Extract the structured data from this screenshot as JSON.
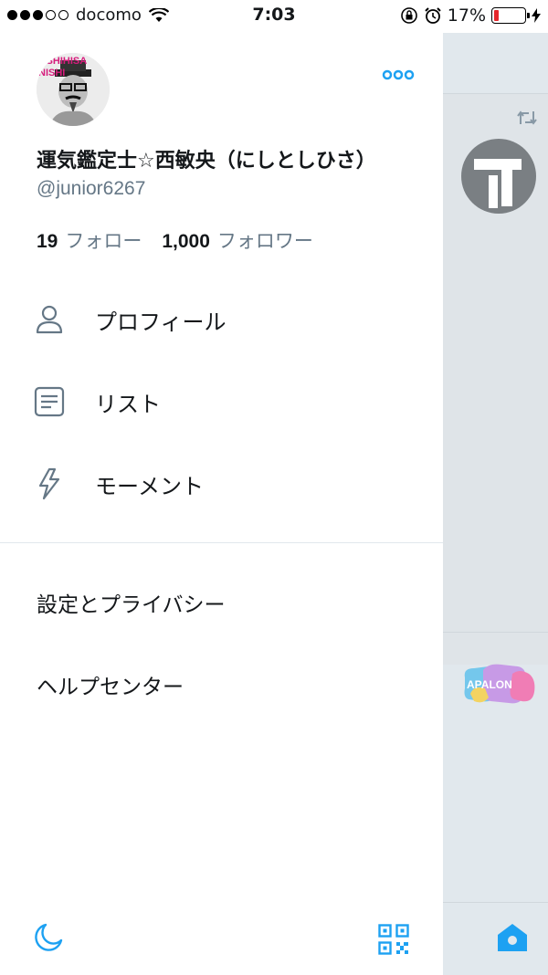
{
  "status_bar": {
    "carrier": "docomo",
    "time": "7:03",
    "battery_percent": "17%",
    "battery_level": 0.17,
    "signal_bars_filled": 3,
    "signal_bars_total": 5
  },
  "profile": {
    "avatar_text": "OSHIHISA NISHI",
    "display_name": "運気鑑定士☆西敏央（にしとしひさ）",
    "handle": "@junior6267",
    "following_count": "19",
    "following_label": "フォロー",
    "followers_count": "1,000",
    "followers_label": "フォロワー",
    "more_icon": "more-dots-icon"
  },
  "menu": [
    {
      "label": "プロフィール",
      "icon": "person-icon"
    },
    {
      "label": "リスト",
      "icon": "list-icon"
    },
    {
      "label": "モーメント",
      "icon": "lightning-icon"
    }
  ],
  "settings": [
    {
      "label": "設定とプライバシー"
    },
    {
      "label": "ヘルプセンター"
    }
  ],
  "bottom": {
    "night_icon": "moon-icon",
    "qr_icon": "qr-code-icon"
  },
  "peek": {
    "apalon_text": "APALON",
    "home_icon": "home-icon",
    "retweet_icon": "retweet-icon"
  },
  "colors": {
    "accent": "#1da1f2",
    "battery_low": "#e5262b",
    "secondary_text": "#657786",
    "peek_bg": "#e1e8ed"
  }
}
